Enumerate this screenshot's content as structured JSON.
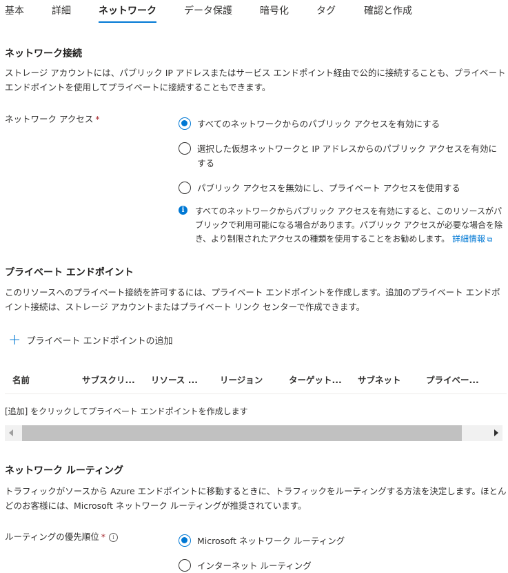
{
  "tabs": [
    {
      "label": "基本",
      "active": false
    },
    {
      "label": "詳細",
      "active": false
    },
    {
      "label": "ネットワーク",
      "active": true
    },
    {
      "label": "データ保護",
      "active": false
    },
    {
      "label": "暗号化",
      "active": false
    },
    {
      "label": "タグ",
      "active": false
    },
    {
      "label": "確認と作成",
      "active": false
    }
  ],
  "network_connection": {
    "title": "ネットワーク接続",
    "description": "ストレージ アカウントには、パブリック IP アドレスまたはサービス エンドポイント経由で公的に接続することも、プライベート エンドポイントを使用してプライベートに接続することもできます。",
    "access_label": "ネットワーク アクセス",
    "required_mark": "*",
    "options": [
      {
        "label": "すべてのネットワークからのパブリック アクセスを有効にする",
        "checked": true
      },
      {
        "label": "選択した仮想ネットワークと IP アドレスからのパブリック アクセスを有効にする",
        "checked": false
      },
      {
        "label": "パブリック アクセスを無効にし、プライベート アクセスを使用する",
        "checked": false
      }
    ],
    "info_text": "すべてのネットワークからパブリック アクセスを有効にすると、このリソースがパブリックで利用可能になる場合があります。パブリック アクセスが必要な場合を除き、より制限されたアクセスの種類を使用することをお勧めします。",
    "info_link": "詳細情報"
  },
  "private_endpoint": {
    "title": "プライベート エンドポイント",
    "description": "このリソースへのプライベート接続を許可するには、プライベート エンドポイントを作成します。追加のプライベート エンドポイント接続は、ストレージ アカウントまたはプライベート リンク センターで作成できます。",
    "add_button": "プライベート エンドポイントの追加",
    "columns": [
      "名前",
      "サブスクリ...",
      "リソース ...",
      "リージョン",
      "ターゲット...",
      "サブネット",
      "プライベー..."
    ],
    "empty_message": "[追加] をクリックしてプライベート エンドポイントを作成します"
  },
  "routing": {
    "title": "ネットワーク ルーティング",
    "description": "トラフィックがソースから Azure エンドポイントに移動するときに、トラフィックをルーティングする方法を決定します。ほとんどのお客様には、Microsoft ネットワーク ルーティングが推奨されています。",
    "priority_label": "ルーティングの優先順位",
    "required_mark": "*",
    "options": [
      {
        "label": "Microsoft ネットワーク ルーティング",
        "checked": true
      },
      {
        "label": "インターネット ルーティング",
        "checked": false
      }
    ]
  },
  "colors": {
    "accent": "#0078d4",
    "required": "#a4262c"
  },
  "icons": {
    "info": "info-icon",
    "add": "plus-icon",
    "external": "external-link-icon"
  }
}
